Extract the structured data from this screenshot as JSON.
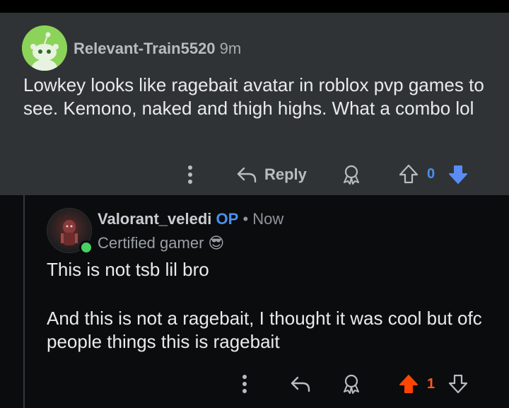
{
  "comment1": {
    "username": "Relevant-Train5520",
    "time": "9m",
    "body": "Lowkey looks like ragebait avatar in roblox pvp games to see. Kemono, naked and thigh highs. What a combo lol",
    "actions": {
      "reply_label": "Reply",
      "score": "0",
      "score_color": "#4a8ff0",
      "downvote_color": "#5a8cf5"
    }
  },
  "comment2": {
    "username": "Valorant_veledi",
    "op_badge": "OP",
    "separator": "•",
    "time": "Now",
    "flair": "Certified gamer",
    "flair_emoji": "😎",
    "body_p1": "This is not tsb lil bro",
    "body_p2": "And this is not a ragebait, I thought it was cool but ofc people things this is ragebait",
    "actions": {
      "score": "1",
      "score_color": "#ff5a1f",
      "upvote_color": "#ff4500"
    }
  }
}
